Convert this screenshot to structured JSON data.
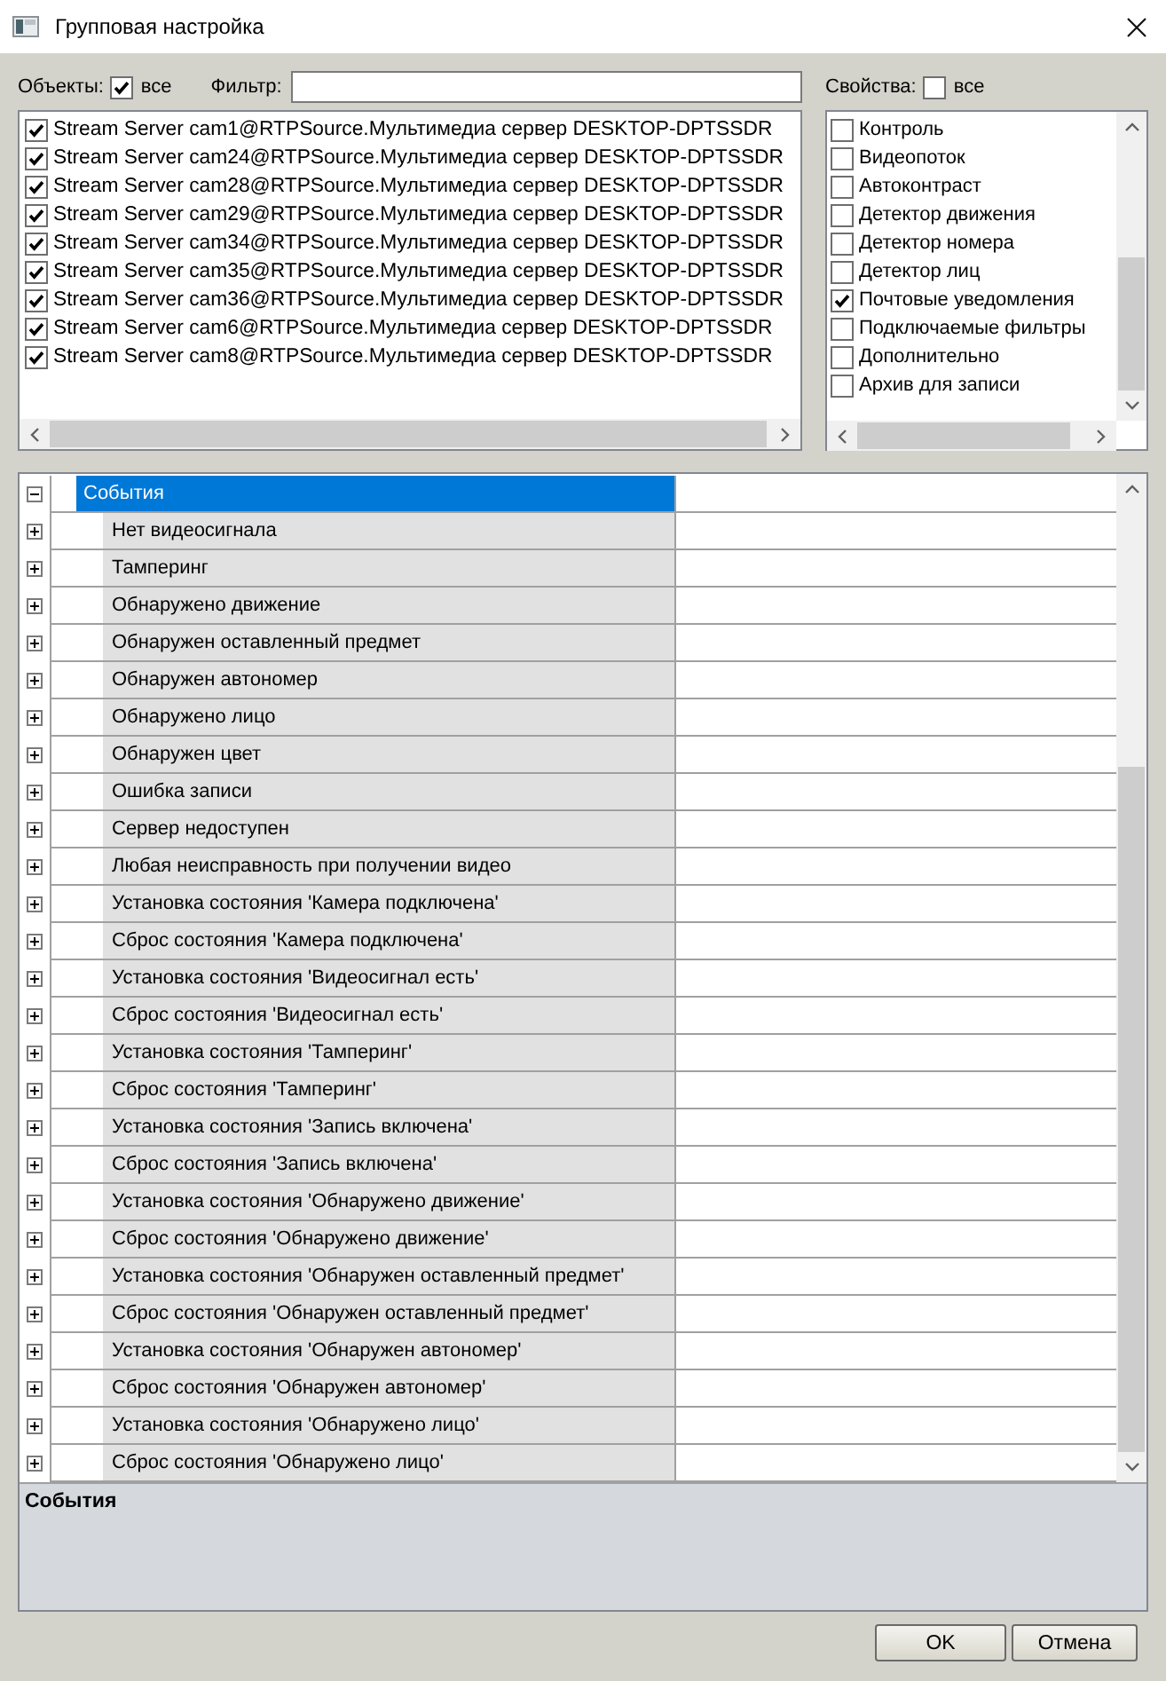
{
  "window": {
    "title": "Групповая настройка"
  },
  "objects": {
    "label": "Объекты:",
    "all": {
      "label": "все",
      "checked": true
    },
    "items": [
      {
        "label": "Stream Server cam1@RTPSource.Мультимедиа сервер DESKTOP-DPTSSDR",
        "checked": true
      },
      {
        "label": "Stream Server cam24@RTPSource.Мультимедиа сервер DESKTOP-DPTSSDR",
        "checked": true
      },
      {
        "label": "Stream Server cam28@RTPSource.Мультимедиа сервер DESKTOP-DPTSSDR",
        "checked": true
      },
      {
        "label": "Stream Server cam29@RTPSource.Мультимедиа сервер DESKTOP-DPTSSDR",
        "checked": true
      },
      {
        "label": "Stream Server cam34@RTPSource.Мультимедиа сервер DESKTOP-DPTSSDR",
        "checked": true
      },
      {
        "label": "Stream Server cam35@RTPSource.Мультимедиа сервер DESKTOP-DPTSSDR",
        "checked": true
      },
      {
        "label": "Stream Server cam36@RTPSource.Мультимедиа сервер DESKTOP-DPTSSDR",
        "checked": true
      },
      {
        "label": "Stream Server cam6@RTPSource.Мультимедиа сервер DESKTOP-DPTSSDR",
        "checked": true
      },
      {
        "label": "Stream Server cam8@RTPSource.Мультимедиа сервер DESKTOP-DPTSSDR",
        "checked": true
      }
    ]
  },
  "filter": {
    "label": "Фильтр:"
  },
  "properties": {
    "label": "Свойства:",
    "all": {
      "label": "все",
      "checked": false
    },
    "items": [
      {
        "label": "Контроль",
        "checked": false
      },
      {
        "label": "Видеопоток",
        "checked": false
      },
      {
        "label": "Автоконтраст",
        "checked": false
      },
      {
        "label": "Детектор движения",
        "checked": false
      },
      {
        "label": "Детектор номера",
        "checked": false
      },
      {
        "label": "Детектор лиц",
        "checked": false
      },
      {
        "label": "Почтовые уведомления",
        "checked": true
      },
      {
        "label": "Подключаемые фильтры",
        "checked": false
      },
      {
        "label": "Дополнительно",
        "checked": false
      },
      {
        "label": "Архив для записи",
        "checked": false
      }
    ]
  },
  "grid": {
    "nodes": [
      {
        "label": "События",
        "expanded": true,
        "selected": true,
        "children": [
          {
            "label": "Нет видеосигнала",
            "expanded": false,
            "selected": false
          },
          {
            "label": "Тамперинг",
            "expanded": false,
            "selected": false
          },
          {
            "label": "Обнаружено движение",
            "expanded": false,
            "selected": false
          },
          {
            "label": "Обнаружен оставленный предмет",
            "expanded": false,
            "selected": false
          },
          {
            "label": "Обнаружен автономер",
            "expanded": false,
            "selected": false
          },
          {
            "label": "Обнаружено лицо",
            "expanded": false,
            "selected": false
          },
          {
            "label": "Обнаружен цвет",
            "expanded": false,
            "selected": false
          },
          {
            "label": "Ошибка записи",
            "expanded": false,
            "selected": false
          },
          {
            "label": "Сервер недоступен",
            "expanded": false,
            "selected": false
          },
          {
            "label": "Любая неисправность при получении видео",
            "expanded": false,
            "selected": false
          },
          {
            "label": "Установка состояния 'Камера подключена'",
            "expanded": false,
            "selected": false
          },
          {
            "label": "Сброс состояния 'Камера подключена'",
            "expanded": false,
            "selected": false
          },
          {
            "label": "Установка состояния 'Видеосигнал есть'",
            "expanded": false,
            "selected": false
          },
          {
            "label": "Сброс состояния 'Видеосигнал есть'",
            "expanded": false,
            "selected": false
          },
          {
            "label": "Установка состояния 'Тамперинг'",
            "expanded": false,
            "selected": false
          },
          {
            "label": "Сброс состояния 'Тамперинг'",
            "expanded": false,
            "selected": false
          },
          {
            "label": "Установка состояния 'Запись включена'",
            "expanded": false,
            "selected": false
          },
          {
            "label": "Сброс состояния 'Запись включена'",
            "expanded": false,
            "selected": false
          },
          {
            "label": "Установка состояния 'Обнаружено движение'",
            "expanded": false,
            "selected": false
          },
          {
            "label": "Сброс состояния 'Обнаружено движение'",
            "expanded": false,
            "selected": false
          },
          {
            "label": "Установка состояния 'Обнаружен оставленный предмет'",
            "expanded": false,
            "selected": false
          },
          {
            "label": "Сброс состояния 'Обнаружен оставленный предмет'",
            "expanded": false,
            "selected": false
          },
          {
            "label": "Установка состояния 'Обнаружен автономер'",
            "expanded": false,
            "selected": false
          },
          {
            "label": "Сброс состояния 'Обнаружен автономер'",
            "expanded": false,
            "selected": false
          },
          {
            "label": "Установка состояния 'Обнаружено лицо'",
            "expanded": false,
            "selected": false
          },
          {
            "label": "Сброс состояния 'Обнаружено лицо'",
            "expanded": false,
            "selected": false
          }
        ]
      }
    ]
  },
  "description": {
    "title": "События"
  },
  "buttons": [
    {
      "label": "OK"
    },
    {
      "label": "Отмена"
    }
  ]
}
